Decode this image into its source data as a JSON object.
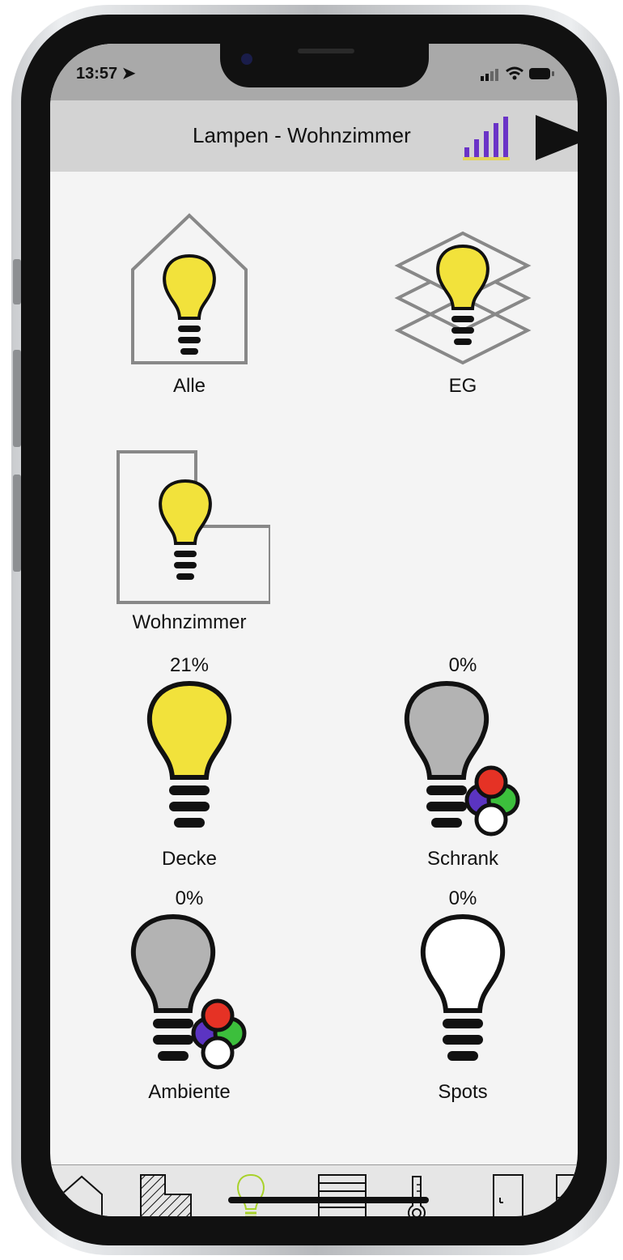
{
  "status": {
    "time": "13:57 ➤",
    "icons": "▂▄ ◠ ▭"
  },
  "header": {
    "title": "Lampen - Wohnzimmer"
  },
  "groups": [
    {
      "label": "Alle"
    },
    {
      "label": "EG"
    },
    {
      "label": "Wohnzimmer"
    }
  ],
  "lamps": [
    {
      "label": "Decke",
      "percent": "21%",
      "color": "#f2e23b",
      "rgb": false
    },
    {
      "label": "Schrank",
      "percent": "0%",
      "color": "#b3b3b3",
      "rgb": true
    },
    {
      "label": "Ambiente",
      "percent": "0%",
      "color": "#b3b3b3",
      "rgb": true
    },
    {
      "label": "Spots",
      "percent": "0%",
      "color": "#ffffff",
      "rgb": false
    }
  ],
  "tabs": [
    "home-icon",
    "floor-icon",
    "lamp-icon",
    "shutter-icon",
    "thermometer-icon",
    "door-icon",
    "window-icon"
  ],
  "colors": {
    "accent": "#6a33c7",
    "active_tab": "#a8d22a",
    "bulb_on": "#f2e23b"
  }
}
